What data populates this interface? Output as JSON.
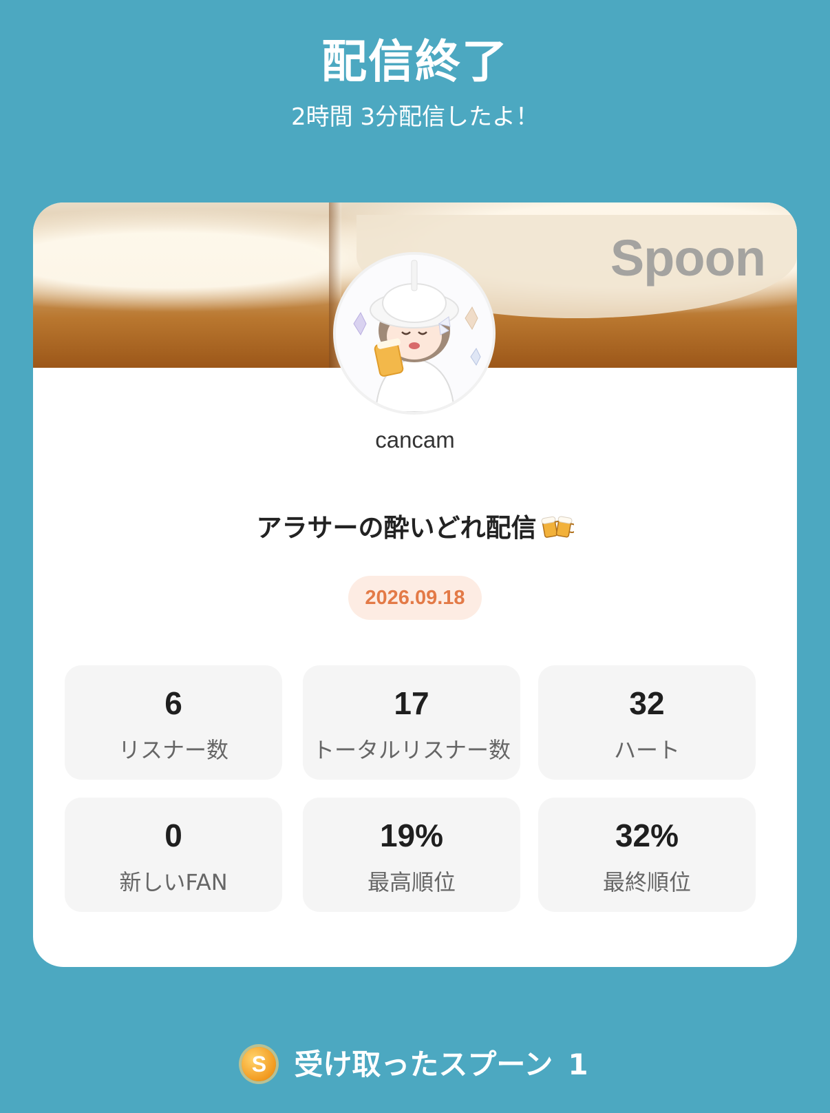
{
  "header": {
    "title": "配信終了",
    "subtitle": "2時間 3分配信したよ！"
  },
  "card": {
    "brand": "Spoon",
    "username": "cancam",
    "live_title": "アラサーの酔いどれ配信",
    "live_title_emoji": "beer-mugs-icon",
    "date": "2026.09.18",
    "stats": [
      {
        "value": "6",
        "label": "リスナー数"
      },
      {
        "value": "17",
        "label": "トータルリスナー数"
      },
      {
        "value": "32",
        "label": "ハート"
      },
      {
        "value": "0",
        "label": "新しいFAN"
      },
      {
        "value": "19%",
        "label": "最高順位"
      },
      {
        "value": "32%",
        "label": "最終順位"
      }
    ]
  },
  "footer": {
    "coin_letter": "S",
    "label": "受け取ったスプーン",
    "count": "1"
  },
  "colors": {
    "background": "#4ca8c1",
    "card": "#ffffff",
    "date_text": "#e37a47",
    "date_bg": "#fdece3",
    "stat_bg": "#f5f5f5"
  }
}
